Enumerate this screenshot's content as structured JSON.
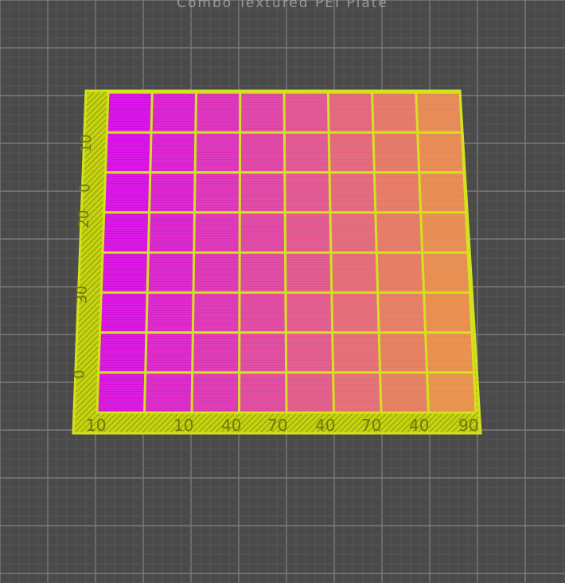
{
  "app": {
    "title": "Combo Textured PEI Plate"
  },
  "model": {
    "grid": {
      "rows": 8,
      "cols": 8
    },
    "x_labels": [
      "10",
      "40",
      "70",
      "40",
      "70",
      "40",
      "90"
    ],
    "y_labels": [
      "10",
      "0",
      "20",
      "30",
      "0"
    ],
    "corner_label": "10",
    "colors": {
      "start": "#d400ef",
      "end": "#e88f45",
      "frame": "#d4e11d",
      "background": "#4a4a4a",
      "grid_line": "#6a6a6a"
    }
  }
}
